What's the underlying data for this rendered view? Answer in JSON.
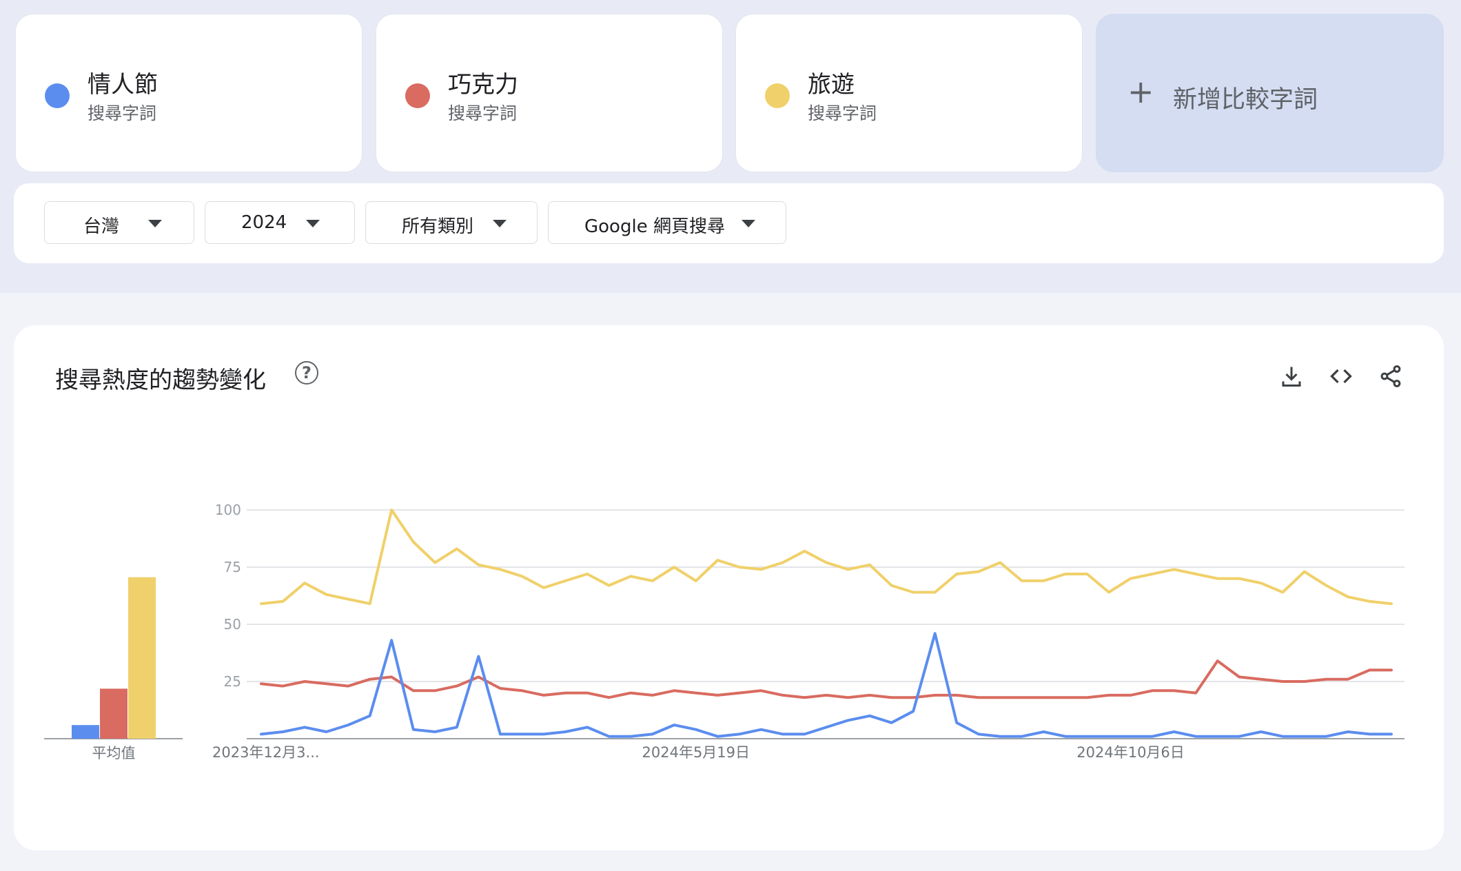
{
  "terms": [
    {
      "name": "情人節",
      "type": "搜尋字詞",
      "color": "#5b8def"
    },
    {
      "name": "巧克力",
      "type": "搜尋字詞",
      "color": "#d96b60"
    },
    {
      "name": "旅遊",
      "type": "搜尋字詞",
      "color": "#f0d06a"
    }
  ],
  "add_compare": {
    "plus": "+",
    "label": "新增比較字詞"
  },
  "filters": {
    "region": "台灣",
    "period": "2024",
    "category": "所有類別",
    "search_type": "Google 網頁搜尋"
  },
  "card": {
    "title": "搜尋熱度的趨勢變化",
    "help_glyph": "?",
    "icons": [
      "download-icon",
      "embed-code-icon",
      "share-icon"
    ]
  },
  "chart_data": [
    {
      "type": "bar",
      "categories": [
        "平均值"
      ],
      "series": [
        {
          "name": "情人節",
          "values": [
            6
          ]
        },
        {
          "name": "巧克力",
          "values": [
            22
          ]
        },
        {
          "name": "旅遊",
          "values": [
            71
          ]
        }
      ],
      "ylim": [
        0,
        100
      ]
    },
    {
      "type": "line",
      "x": [
        "2023-12-31",
        "2024-01-07",
        "2024-01-14",
        "2024-01-21",
        "2024-01-28",
        "2024-02-04",
        "2024-02-11",
        "2024-02-18",
        "2024-02-25",
        "2024-03-03",
        "2024-03-10",
        "2024-03-17",
        "2024-03-24",
        "2024-03-31",
        "2024-04-07",
        "2024-04-14",
        "2024-04-21",
        "2024-04-28",
        "2024-05-05",
        "2024-05-12",
        "2024-05-19",
        "2024-05-26",
        "2024-06-02",
        "2024-06-09",
        "2024-06-16",
        "2024-06-23",
        "2024-06-30",
        "2024-07-07",
        "2024-07-14",
        "2024-07-21",
        "2024-07-28",
        "2024-08-04",
        "2024-08-11",
        "2024-08-18",
        "2024-08-25",
        "2024-09-01",
        "2024-09-08",
        "2024-09-15",
        "2024-09-22",
        "2024-09-29",
        "2024-10-06",
        "2024-10-13",
        "2024-10-20",
        "2024-10-27",
        "2024-11-03",
        "2024-11-10",
        "2024-11-17",
        "2024-11-24",
        "2024-12-01",
        "2024-12-08",
        "2024-12-15",
        "2024-12-22",
        "2024-12-29"
      ],
      "x_tick_labels": [
        "2023年12月3...",
        "2024年5月19日",
        "2024年10月6日"
      ],
      "y_ticks": [
        25,
        50,
        75,
        100
      ],
      "ylim": [
        0,
        100
      ],
      "grid": true,
      "series": [
        {
          "name": "情人節",
          "values": [
            2,
            3,
            5,
            3,
            6,
            10,
            43,
            4,
            3,
            5,
            36,
            2,
            2,
            2,
            3,
            5,
            1,
            1,
            2,
            6,
            4,
            1,
            2,
            4,
            2,
            2,
            5,
            8,
            10,
            7,
            12,
            46,
            7,
            2,
            1,
            1,
            3,
            1,
            1,
            1,
            1,
            1,
            3,
            1,
            1,
            1,
            3,
            1,
            1,
            1,
            3,
            2,
            2
          ]
        },
        {
          "name": "巧克力",
          "values": [
            24,
            23,
            25,
            24,
            23,
            26,
            27,
            21,
            21,
            23,
            27,
            22,
            21,
            19,
            20,
            20,
            18,
            20,
            19,
            21,
            20,
            19,
            20,
            21,
            19,
            18,
            19,
            18,
            19,
            18,
            18,
            19,
            19,
            18,
            18,
            18,
            18,
            18,
            18,
            19,
            19,
            21,
            21,
            20,
            34,
            27,
            26,
            25,
            25,
            26,
            26,
            30,
            30
          ]
        },
        {
          "name": "旅遊",
          "values": [
            59,
            60,
            68,
            63,
            61,
            59,
            100,
            86,
            77,
            83,
            76,
            74,
            71,
            66,
            69,
            72,
            67,
            71,
            69,
            75,
            69,
            78,
            75,
            74,
            77,
            82,
            77,
            74,
            76,
            67,
            64,
            64,
            72,
            73,
            77,
            69,
            69,
            72,
            72,
            64,
            70,
            72,
            74,
            72,
            70,
            70,
            68,
            64,
            73,
            67,
            62,
            60,
            59
          ]
        }
      ]
    }
  ]
}
